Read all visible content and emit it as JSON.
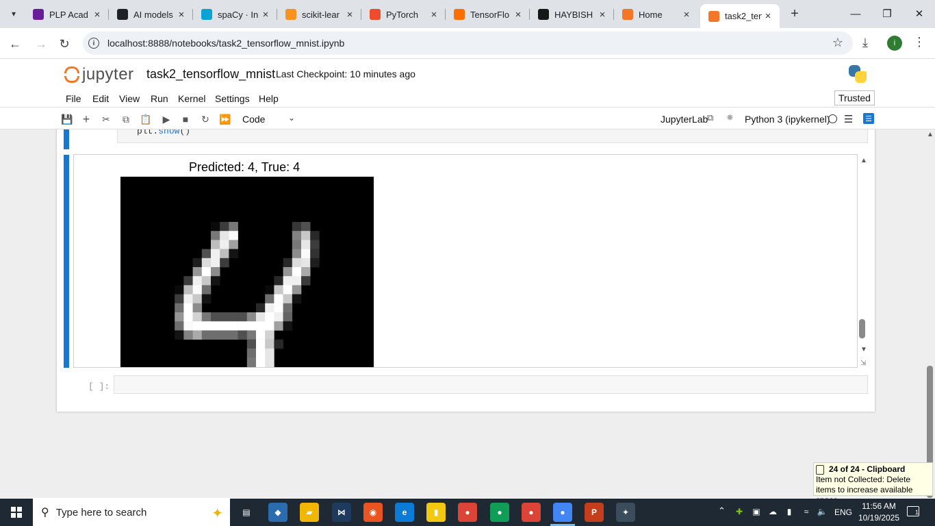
{
  "browser": {
    "tabs": [
      {
        "title": "PLP Acad",
        "favicon": "plp-icon",
        "color": "#6a1b9a"
      },
      {
        "title": "AI models",
        "favicon": "openai-icon",
        "color": "#202124"
      },
      {
        "title": "spaCy · In",
        "favicon": "spacy-icon",
        "color": "#09a3d5"
      },
      {
        "title": "scikit-lear",
        "favicon": "scikit-icon",
        "color": "#f7931e"
      },
      {
        "title": "PyTorch",
        "favicon": "pytorch-icon",
        "color": "#ee4c2c"
      },
      {
        "title": "TensorFlo",
        "favicon": "tensorflow-icon",
        "color": "#ff6f00"
      },
      {
        "title": "HAYBISH",
        "favicon": "github-icon",
        "color": "#181717"
      },
      {
        "title": "Home",
        "favicon": "jupyter-icon",
        "color": "#f37726"
      },
      {
        "title": "task2_ten",
        "favicon": "jupyter-notebook-icon",
        "color": "#f37726"
      }
    ],
    "new_tab": "+",
    "url": "localhost:8888/notebooks/task2_tensorflow_mnist.ipynb",
    "profile_initial": "i"
  },
  "jupyter": {
    "logo_text": "jupyter",
    "notebook_title": "task2_tensorflow_mnist",
    "checkpoint": "Last Checkpoint: 10 minutes ago",
    "menu": [
      "File",
      "Edit",
      "View",
      "Run",
      "Kernel",
      "Settings",
      "Help"
    ],
    "trusted": "Trusted",
    "cell_type": "Code",
    "jupyterlab_link": "JupyterLab",
    "kernel": "Python 3 (ipykernel)"
  },
  "notebook": {
    "prev_code_obj": "plt.",
    "prev_code_call": "show",
    "prev_code_end": "()",
    "plot_title": "Predicted: 4, True: 4",
    "empty_prompt": "[ ]:"
  },
  "clipboard_toast": {
    "title": "24 of 24 - Clipboard",
    "body": "Item not Collected: Delete items to increase available space"
  },
  "taskbar": {
    "search_placeholder": "Type here to search",
    "language": "ENG",
    "time": "11:56 AM",
    "date": "10/19/2025",
    "notification_count": "1",
    "apps": [
      {
        "name": "task-view-icon",
        "color": "#1f2933",
        "glyph": "▤"
      },
      {
        "name": "copilot-icon",
        "color": "#2b6cb0",
        "glyph": "◆"
      },
      {
        "name": "file-explorer-icon",
        "color": "#f2b705",
        "glyph": "▰"
      },
      {
        "name": "visual-studio-icon",
        "color": "#1e3a5f",
        "glyph": "⋈"
      },
      {
        "name": "ubuntu-icon",
        "color": "#e95420",
        "glyph": "◉"
      },
      {
        "name": "edge-icon",
        "color": "#0c7bd6",
        "glyph": "e"
      },
      {
        "name": "power-bi-icon",
        "color": "#f2c811",
        "glyph": "▮"
      },
      {
        "name": "chrome-icon",
        "color": "#db4437",
        "glyph": "●"
      },
      {
        "name": "chrome-profile-2-icon",
        "color": "#0f9d58",
        "glyph": "●"
      },
      {
        "name": "chrome-profile-3-icon",
        "color": "#db4437",
        "glyph": "●"
      },
      {
        "name": "chrome-profile-active-icon",
        "color": "#4285f4",
        "glyph": "●"
      },
      {
        "name": "powerpoint-icon",
        "color": "#c43e1c",
        "glyph": "P"
      },
      {
        "name": "git-icon",
        "color": "#3b4d5c",
        "glyph": "✦"
      }
    ]
  },
  "digit_pixels": [
    [
      0,
      0,
      0,
      0,
      0,
      0,
      0,
      0,
      0,
      0,
      0,
      0,
      0,
      0,
      0,
      0,
      0,
      0,
      0,
      0,
      0,
      0,
      0,
      0,
      0,
      0,
      0,
      0
    ],
    [
      0,
      0,
      0,
      0,
      0,
      0,
      0,
      0,
      0,
      0,
      0,
      0,
      0,
      0,
      0,
      0,
      0,
      0,
      0,
      0,
      0,
      0,
      0,
      0,
      0,
      0,
      0,
      0
    ],
    [
      0,
      0,
      0,
      0,
      0,
      0,
      0,
      0,
      0,
      0,
      0,
      0,
      0,
      0,
      0,
      0,
      0,
      0,
      0,
      0,
      0,
      0,
      0,
      0,
      0,
      0,
      0,
      0
    ],
    [
      0,
      0,
      0,
      0,
      0,
      0,
      0,
      0,
      0,
      0,
      0,
      0,
      0,
      0,
      0,
      0,
      0,
      0,
      0,
      0,
      0,
      0,
      0,
      0,
      0,
      0,
      0,
      0
    ],
    [
      0,
      0,
      0,
      0,
      0,
      0,
      0,
      0,
      0,
      0,
      0,
      0,
      0,
      0,
      0,
      0,
      0,
      0,
      0,
      0,
      0,
      0,
      0,
      0,
      0,
      0,
      0,
      0
    ],
    [
      0,
      0,
      0,
      0,
      0,
      0,
      0,
      0,
      0,
      0,
      10,
      60,
      120,
      0,
      0,
      0,
      0,
      0,
      0,
      55,
      80,
      0,
      0,
      0,
      0,
      0,
      0,
      0
    ],
    [
      0,
      0,
      0,
      0,
      0,
      0,
      0,
      0,
      0,
      0,
      120,
      230,
      250,
      0,
      0,
      0,
      0,
      0,
      0,
      130,
      200,
      40,
      0,
      0,
      0,
      0,
      0,
      0
    ],
    [
      0,
      0,
      0,
      0,
      0,
      0,
      0,
      0,
      0,
      0,
      190,
      240,
      160,
      0,
      0,
      0,
      0,
      0,
      0,
      120,
      230,
      60,
      0,
      0,
      0,
      0,
      0,
      0
    ],
    [
      0,
      0,
      0,
      0,
      0,
      0,
      0,
      0,
      0,
      80,
      240,
      190,
      20,
      0,
      0,
      0,
      0,
      0,
      0,
      140,
      250,
      50,
      0,
      0,
      0,
      0,
      0,
      0
    ],
    [
      0,
      0,
      0,
      0,
      0,
      0,
      0,
      0,
      30,
      220,
      240,
      60,
      0,
      0,
      0,
      0,
      0,
      0,
      40,
      220,
      230,
      30,
      0,
      0,
      0,
      0,
      0,
      0
    ],
    [
      0,
      0,
      0,
      0,
      0,
      0,
      0,
      0,
      150,
      255,
      140,
      0,
      0,
      0,
      0,
      0,
      0,
      0,
      150,
      255,
      170,
      0,
      0,
      0,
      0,
      0,
      0,
      0
    ],
    [
      0,
      0,
      0,
      0,
      0,
      0,
      0,
      60,
      240,
      200,
      20,
      0,
      0,
      0,
      0,
      0,
      0,
      40,
      240,
      240,
      60,
      0,
      0,
      0,
      0,
      0,
      0,
      0
    ],
    [
      0,
      0,
      0,
      0,
      0,
      0,
      10,
      190,
      250,
      110,
      0,
      0,
      0,
      0,
      0,
      0,
      10,
      200,
      255,
      150,
      0,
      0,
      0,
      0,
      0,
      0,
      0,
      0
    ],
    [
      0,
      0,
      0,
      0,
      0,
      0,
      60,
      240,
      200,
      20,
      0,
      0,
      0,
      0,
      0,
      0,
      110,
      255,
      200,
      20,
      0,
      0,
      0,
      0,
      0,
      0,
      0,
      0
    ],
    [
      0,
      0,
      0,
      0,
      0,
      0,
      110,
      255,
      140,
      0,
      0,
      0,
      0,
      0,
      0,
      40,
      240,
      255,
      110,
      0,
      0,
      0,
      0,
      0,
      0,
      0,
      0,
      0
    ],
    [
      0,
      0,
      0,
      0,
      0,
      0,
      150,
      255,
      210,
      120,
      80,
      80,
      80,
      80,
      140,
      230,
      255,
      240,
      100,
      0,
      0,
      0,
      0,
      0,
      0,
      0,
      0,
      0
    ],
    [
      0,
      0,
      0,
      0,
      0,
      0,
      110,
      250,
      255,
      255,
      255,
      255,
      255,
      255,
      255,
      255,
      255,
      160,
      20,
      0,
      0,
      0,
      0,
      0,
      0,
      0,
      0,
      0
    ],
    [
      0,
      0,
      0,
      0,
      0,
      0,
      20,
      130,
      170,
      110,
      110,
      110,
      110,
      80,
      120,
      255,
      210,
      0,
      0,
      0,
      0,
      0,
      0,
      0,
      0,
      0,
      0,
      0
    ],
    [
      0,
      0,
      0,
      0,
      0,
      0,
      0,
      0,
      0,
      0,
      0,
      0,
      0,
      0,
      80,
      255,
      200,
      40,
      0,
      0,
      0,
      0,
      0,
      0,
      0,
      0,
      0,
      0
    ],
    [
      0,
      0,
      0,
      0,
      0,
      0,
      0,
      0,
      0,
      0,
      0,
      0,
      0,
      0,
      110,
      255,
      230,
      0,
      0,
      0,
      0,
      0,
      0,
      0,
      0,
      0,
      0,
      0
    ],
    [
      0,
      0,
      0,
      0,
      0,
      0,
      0,
      0,
      0,
      0,
      0,
      0,
      0,
      0,
      120,
      255,
      230,
      0,
      0,
      0,
      0,
      0,
      0,
      0,
      0,
      0,
      0,
      0
    ],
    [
      0,
      0,
      0,
      0,
      0,
      0,
      0,
      0,
      0,
      0,
      0,
      0,
      0,
      0,
      120,
      255,
      230,
      0,
      0,
      0,
      0,
      0,
      0,
      0,
      0,
      0,
      0,
      0
    ]
  ]
}
